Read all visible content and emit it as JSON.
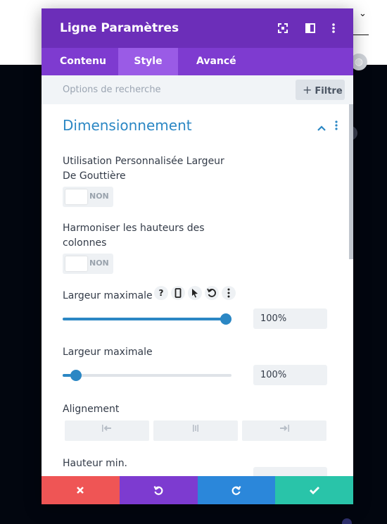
{
  "modal": {
    "title": "Ligne Paramètres",
    "tabs": [
      {
        "label": "Contenu",
        "active": false
      },
      {
        "label": "Style",
        "active": true
      },
      {
        "label": "Avancé",
        "active": false
      }
    ],
    "search_placeholder": "Options de recherche",
    "filter_label": "Filtre"
  },
  "section": {
    "title": "Dimensionnement",
    "custom_gutter": {
      "label_line1": "Utilisation Personnalisée Largeur",
      "label_line2": "De Gouttière",
      "toggle": "NON"
    },
    "equal_heights": {
      "label_line1": "Harmoniser les hauteurs des",
      "label_line2": "colonnes",
      "toggle": "NON"
    },
    "width": {
      "label": "Largeur maximale",
      "value": "100%",
      "level": 1.0
    },
    "max_width": {
      "label": "Largeur maximale",
      "value": "100%",
      "level": 0.05
    },
    "alignment": {
      "label": "Alignement"
    },
    "min_height": {
      "label": "Hauteur min."
    }
  },
  "colors": {
    "header": "#6c2eb9",
    "tabs": "#7e3bd0",
    "active_tab": "#9a5be6",
    "accent": "#2b87c4",
    "cancel": "#ef5555",
    "undo": "#7d3bd0",
    "redo": "#2b87da",
    "save": "#29c4a9"
  },
  "icons": [
    "expand-icon",
    "split-view-icon",
    "more-icon",
    "plus-icon",
    "chevron-up-icon",
    "help-icon",
    "mobile-icon",
    "cursor-icon",
    "reset-icon",
    "align-left-icon",
    "align-center-icon",
    "align-right-icon",
    "close-icon",
    "undo-icon",
    "redo-icon",
    "check-icon"
  ]
}
